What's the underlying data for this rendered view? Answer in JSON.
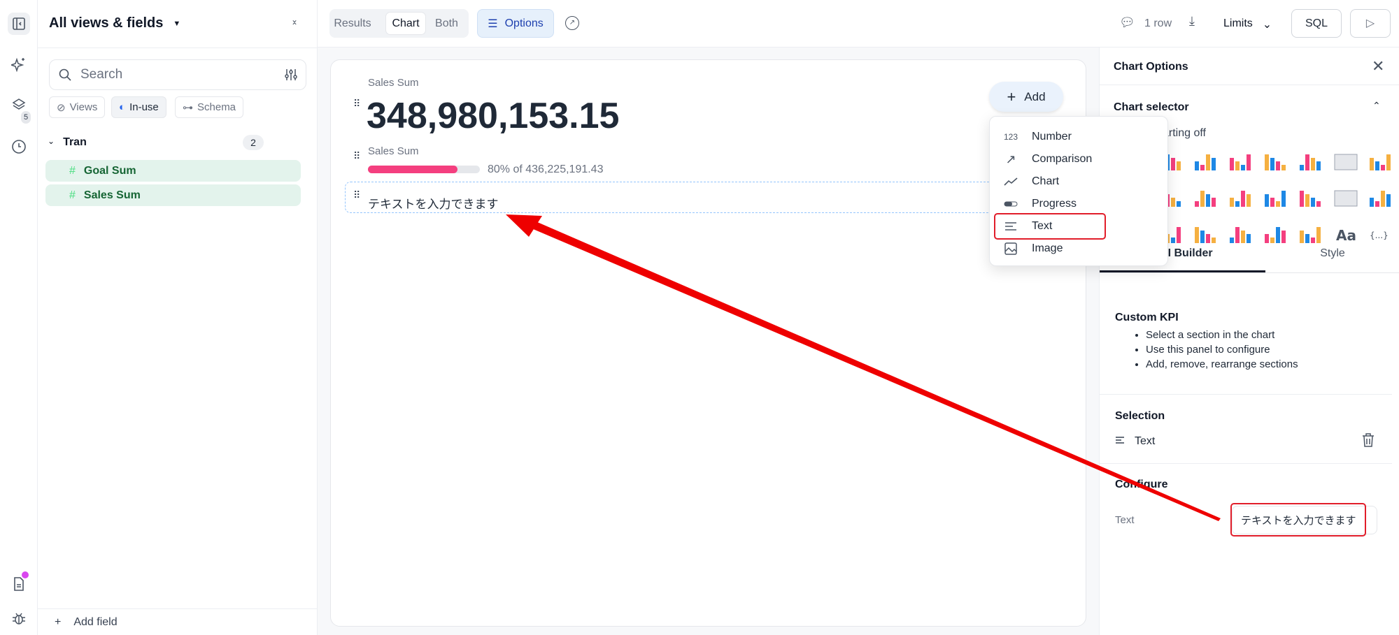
{
  "rail": {
    "layers_badge": "5"
  },
  "left_panel": {
    "title": "All views & fields",
    "search_placeholder": "Search",
    "filters": [
      "Views",
      "In-use",
      "Schema"
    ],
    "group": {
      "name": "Tran",
      "count": "2"
    },
    "fields": [
      "Goal Sum",
      "Sales Sum"
    ],
    "add_field": "Add field"
  },
  "toolbar": {
    "tabs": [
      "Results",
      "Chart",
      "Both"
    ],
    "active_tab": "Chart",
    "options": "Options",
    "rows": "1 row",
    "limits": "Limits",
    "sql": "SQL"
  },
  "kpi": {
    "number_label": "Sales Sum",
    "number_value": "348,980,153.15",
    "progress_label": "Sales Sum",
    "progress_fraction": 0.8,
    "progress_text": "80% of 436,225,191.43",
    "text_section": "テキストを入力できます",
    "add_button": "Add"
  },
  "add_menu": {
    "items": [
      {
        "icon": "123",
        "label": "Number"
      },
      {
        "icon": "arrow-up-right-icon",
        "label": "Comparison"
      },
      {
        "icon": "line-chart-icon",
        "label": "Chart"
      },
      {
        "icon": "progress-icon",
        "label": "Progress"
      },
      {
        "icon": "text-align-icon",
        "label": "Text"
      },
      {
        "icon": "image-icon",
        "label": "Image"
      }
    ],
    "highlighted": "Text"
  },
  "right_panel": {
    "title": "Chart Options",
    "chart_selector": "Chart selector",
    "charting_hint": "arting off",
    "tabs": [
      "KPI Builder",
      "Style"
    ],
    "custom_kpi": {
      "title": "Custom KPI",
      "bullets": [
        "Select a section in the chart",
        "Use this panel to configure",
        "Add, remove, rearrange sections"
      ]
    },
    "selection": {
      "title": "Selection",
      "item": "Text"
    },
    "configure": {
      "title": "Configure",
      "text_label": "Text",
      "text_value": "テキストを入力できます"
    }
  },
  "colors": {
    "accent": "#2563eb",
    "progress": "#f43f7f",
    "field_bg": "#e3f3ec",
    "annotation": "#ee0000"
  }
}
